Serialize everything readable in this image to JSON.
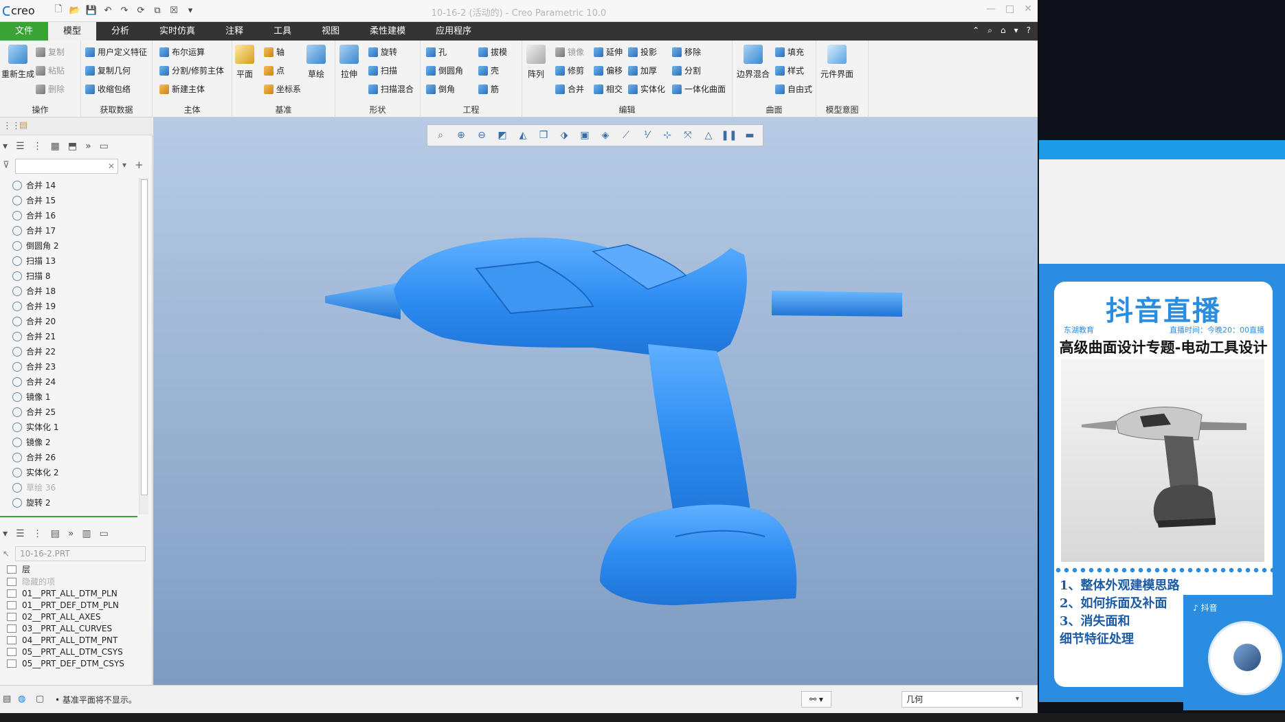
{
  "app": {
    "logo": "creo",
    "window_title": "10-16-2 (活动的) - Creo Parametric 10.0",
    "win_controls": [
      "—",
      "□",
      "✕"
    ]
  },
  "menu": {
    "tabs": [
      "文件",
      "模型",
      "分析",
      "实时仿真",
      "注释",
      "工具",
      "视图",
      "柔性建模",
      "应用程序"
    ],
    "active": "模型"
  },
  "ribbon": {
    "groups": {
      "operations": {
        "label": "操作",
        "regen": "重新生成",
        "copy": "复制",
        "paste": "粘贴",
        "delete": "删除"
      },
      "get_data": {
        "label": "获取数据",
        "udf": "用户定义特征",
        "copy_geom": "复制几何",
        "shrinkwrap": "收缩包络"
      },
      "body": {
        "label": "主体",
        "boolean": "布尔运算",
        "split": "分割/修剪主体",
        "new_body": "新建主体"
      },
      "datum": {
        "label": "基准",
        "plane": "平面",
        "axis": "轴",
        "point": "点",
        "csys": "坐标系",
        "sketch": "草绘"
      },
      "shapes": {
        "label": "形状",
        "extrude": "拉伸",
        "revolve": "旋转",
        "sweep": "扫描",
        "swept_blend": "扫描混合"
      },
      "engineering": {
        "label": "工程",
        "hole": "孔",
        "round": "倒圆角",
        "chamfer": "倒角",
        "draft": "拔模",
        "shell": "壳",
        "rib": "筋"
      },
      "editing": {
        "label": "编辑",
        "pattern": "阵列",
        "mirror": "镜像",
        "trim": "修剪",
        "merge": "合并",
        "extend": "延伸",
        "offset": "偏移",
        "intersect": "相交",
        "project": "投影",
        "thicken": "加厚",
        "solidify": "实体化",
        "remove": "移除",
        "split": "分割",
        "unify": "一体化曲面"
      },
      "surfaces": {
        "label": "曲面",
        "boundary": "边界混合",
        "fill": "填充",
        "style": "样式",
        "freestyle": "自由式"
      },
      "model_intent": {
        "label": "模型意图",
        "component_interface": "元件界面"
      }
    }
  },
  "model_tree": {
    "search_placeholder": "",
    "items": [
      {
        "label": "合并 14",
        "muted": false
      },
      {
        "label": "合并 15",
        "muted": false
      },
      {
        "label": "合并 16",
        "muted": false
      },
      {
        "label": "合并 17",
        "muted": false
      },
      {
        "label": "倒圆角 2",
        "muted": false
      },
      {
        "label": "扫描 13",
        "muted": false
      },
      {
        "label": "扫描 8",
        "muted": false
      },
      {
        "label": "合并 18",
        "muted": false
      },
      {
        "label": "合并 19",
        "muted": false
      },
      {
        "label": "合并 20",
        "muted": false
      },
      {
        "label": "合并 21",
        "muted": false
      },
      {
        "label": "合并 22",
        "muted": false
      },
      {
        "label": "合并 23",
        "muted": false
      },
      {
        "label": "合并 24",
        "muted": false
      },
      {
        "label": "镜像 1",
        "muted": false
      },
      {
        "label": "合并 25",
        "muted": false
      },
      {
        "label": "实体化 1",
        "muted": false
      },
      {
        "label": "镜像 2",
        "muted": false
      },
      {
        "label": "合并 26",
        "muted": false
      },
      {
        "label": "实体化 2",
        "muted": false
      },
      {
        "label": "草绘 36",
        "muted": true
      },
      {
        "label": "旋转 2",
        "muted": false
      }
    ]
  },
  "layer_tree": {
    "part": "10-16-2.PRT",
    "header": "层",
    "items": [
      {
        "label": "隐藏的项",
        "muted": true
      },
      {
        "label": "01__PRT_ALL_DTM_PLN",
        "muted": false
      },
      {
        "label": "01__PRT_DEF_DTM_PLN",
        "muted": false
      },
      {
        "label": "02__PRT_ALL_AXES",
        "muted": false
      },
      {
        "label": "03__PRT_ALL_CURVES",
        "muted": false
      },
      {
        "label": "04__PRT_ALL_DTM_PNT",
        "muted": false
      },
      {
        "label": "05__PRT_ALL_DTM_CSYS",
        "muted": false
      },
      {
        "label": "05__PRT_DEF_DTM_CSYS",
        "muted": false
      }
    ]
  },
  "status": {
    "message": "• 基准平面将不显示。",
    "filter": "几何"
  },
  "poster": {
    "title": "抖音直播",
    "org": "东湖教育",
    "time": "直播时间：今晚20：00直播",
    "headline": "高级曲面设计专题-电动工具设计",
    "list": [
      "1、整体外观建模思路",
      "2、如何拆面及补面",
      "3、消失面和",
      "细节特征处理"
    ],
    "douyin": "抖音"
  },
  "colors": {
    "accent_green": "#3aa336",
    "menubar": "#343434",
    "model_blue": "#2e8cf2",
    "poster_blue": "#2b8de0"
  }
}
